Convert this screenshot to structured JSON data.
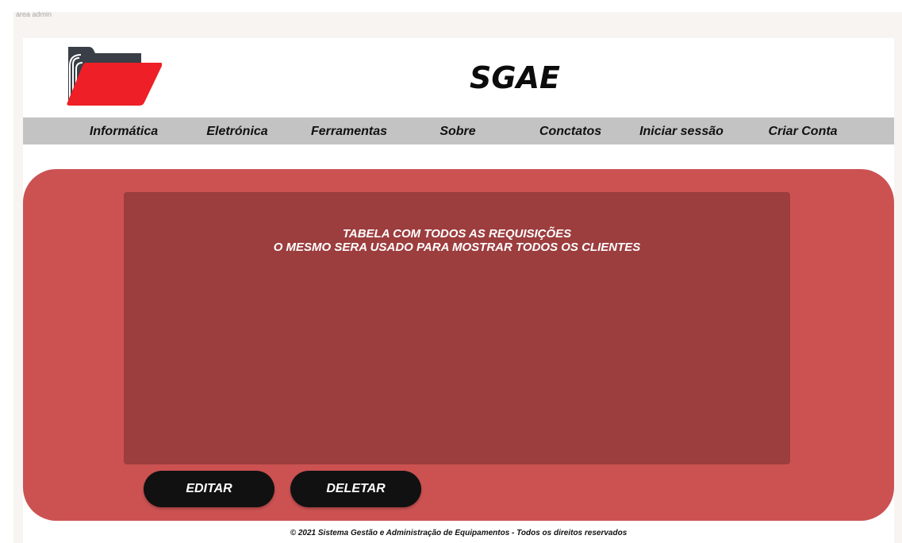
{
  "frame": {
    "label": "area admin"
  },
  "header": {
    "logo_icon": "folder-icon",
    "title": "SGAE"
  },
  "nav": {
    "items": [
      {
        "label": "Informática"
      },
      {
        "label": "Eletrónica"
      },
      {
        "label": "Ferramentas"
      },
      {
        "label": "Sobre"
      },
      {
        "label": "Conctatos"
      },
      {
        "label": "Iniciar sessão"
      },
      {
        "label": "Criar Conta"
      }
    ]
  },
  "main": {
    "table_text_line1": "TABELA COM TODOS AS REQUISIÇÕES",
    "table_text_line2": "O MESMO SERA USADO PARA MOSTRAR TODOS OS CLIENTES",
    "edit_label": "EDITAR",
    "delete_label": "DELETAR"
  },
  "footer": {
    "text": "© 2021 Sistema Gestão e Administração de Equipamentos - Todos os direitos reservados"
  },
  "colors": {
    "panel": "#cc5252",
    "table_area": "#9c3d3e",
    "navbar": "#c3c3c3",
    "logo_red": "#ee1f26",
    "button": "#111111"
  }
}
